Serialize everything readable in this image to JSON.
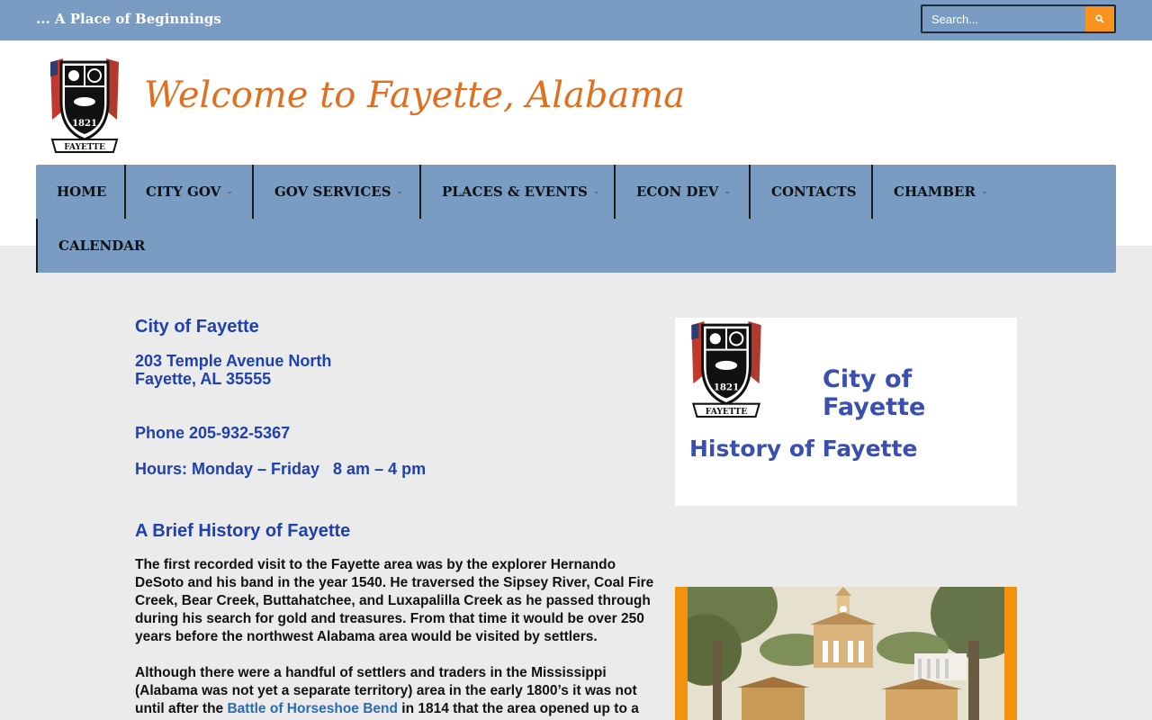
{
  "topbar": {
    "tagline": "... A Place of Beginnings",
    "search_placeholder": "Search..."
  },
  "header": {
    "site_title": "Welcome to Fayette, Alabama",
    "logo_year": "1821",
    "logo_banner": "FAYETTE"
  },
  "nav": {
    "items": [
      {
        "label": "HOME",
        "has_dropdown": false
      },
      {
        "label": "CITY GOV",
        "has_dropdown": true
      },
      {
        "label": "GOV SERVICES",
        "has_dropdown": true
      },
      {
        "label": "PLACES & EVENTS",
        "has_dropdown": true
      },
      {
        "label": "ECON DEV",
        "has_dropdown": true
      },
      {
        "label": "CONTACTS",
        "has_dropdown": false
      },
      {
        "label": "CHAMBER",
        "has_dropdown": true
      },
      {
        "label": "CALENDAR",
        "has_dropdown": false
      }
    ]
  },
  "contact": {
    "heading": "City of Fayette",
    "address_line1": "203 Temple Avenue North",
    "address_line2": "Fayette, AL 35555",
    "phone": "Phone 205-932-5367",
    "hours": "Hours: Monday – Friday   8 am – 4 pm"
  },
  "history": {
    "heading": "A Brief History of Fayette",
    "paragraph1": "The first recorded visit to the Fayette area was by the explorer Hernando DeSoto and his band in the year 1540. He traversed the Sipsey River, Coal Fire Creek, Bear Creek, Buttahatchee, and Luxapalilla Creek as he passed through during his search for gold and treasures. From that time it would be over 250 years before the northwest Alabama area would be visited by settlers.",
    "paragraph2_before": "Although there were a handful of settlers and traders in the Mississippi (Alabama was not yet a separate territory) area in the early 1800’s it was not until after the ",
    "paragraph2_link": "Battle of Horseshoe Bend",
    "paragraph2_after": " in 1814 that the area opened up to a"
  },
  "side_panel": {
    "title": "City of Fayette",
    "subtitle": "History of Fayette"
  },
  "colors": {
    "topbar": "#7a9cc2",
    "accent_orange": "#f7931e",
    "title_orange": "#e0701f",
    "heading_blue": "#1e40b0"
  }
}
